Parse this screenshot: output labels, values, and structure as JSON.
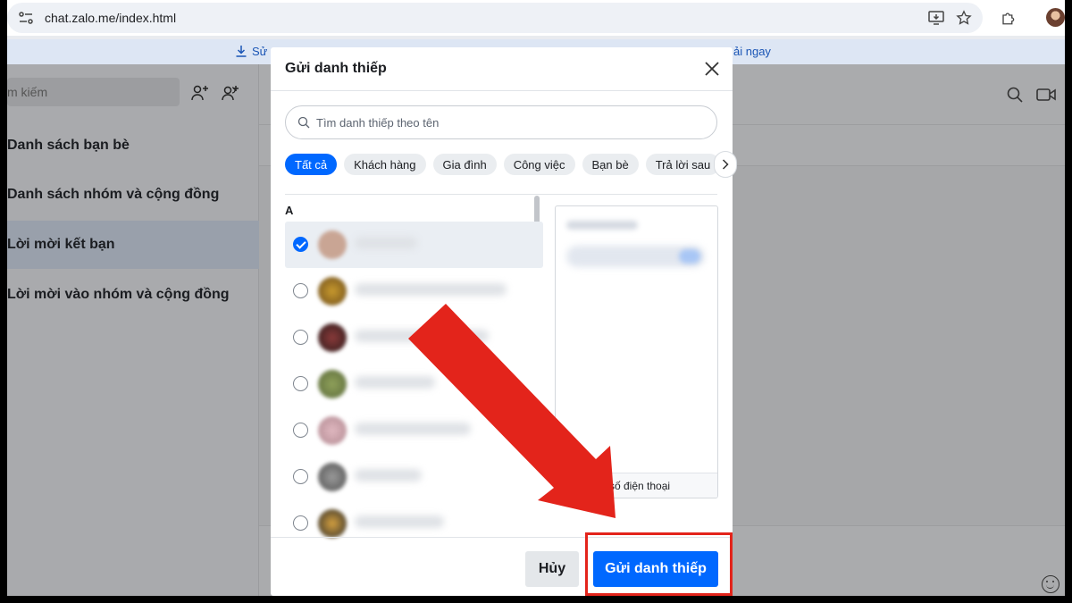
{
  "browser": {
    "url": "chat.zalo.me/index.html",
    "banner_left": "Sử",
    "banner_right": "ải ngay"
  },
  "sidebar": {
    "search_placeholder": "m kiếm",
    "items": [
      {
        "label": "Danh sách bạn bè",
        "active": false
      },
      {
        "label": "Danh sách nhóm và cộng đồng",
        "active": false
      },
      {
        "label": "Lời mời kết bạn",
        "active": true
      },
      {
        "label": "Lời mời vào nhóm và cộng đồng",
        "active": false
      }
    ]
  },
  "modal": {
    "title": "Gửi danh thiếp",
    "search_placeholder": "Tìm danh thiếp theo tên",
    "chips": [
      {
        "label": "Tất cả",
        "active": true
      },
      {
        "label": "Khách hàng",
        "active": false
      },
      {
        "label": "Gia đình",
        "active": false
      },
      {
        "label": "Công việc",
        "active": false
      },
      {
        "label": "Bạn bè",
        "active": false
      },
      {
        "label": "Trả lời sau",
        "active": false
      }
    ],
    "section_letter": "A",
    "contacts": [
      {
        "checked": true
      },
      {
        "checked": false
      },
      {
        "checked": false
      },
      {
        "checked": false
      },
      {
        "checked": false
      },
      {
        "checked": false
      },
      {
        "checked": false
      }
    ],
    "phone_option_label": "kèm số điện thoại",
    "cancel_label": "Hủy",
    "send_label": "Gửi danh thiếp"
  },
  "colors": {
    "accent": "#0068ff",
    "annotation": "#e3241b"
  },
  "icons": [
    "site-info-icon",
    "install-icon",
    "star-icon",
    "extensions-icon",
    "download-icon",
    "add-friend-icon",
    "create-group-icon",
    "search-icon",
    "video-call-icon",
    "close-icon",
    "chevron-right-icon",
    "emoji-icon"
  ]
}
